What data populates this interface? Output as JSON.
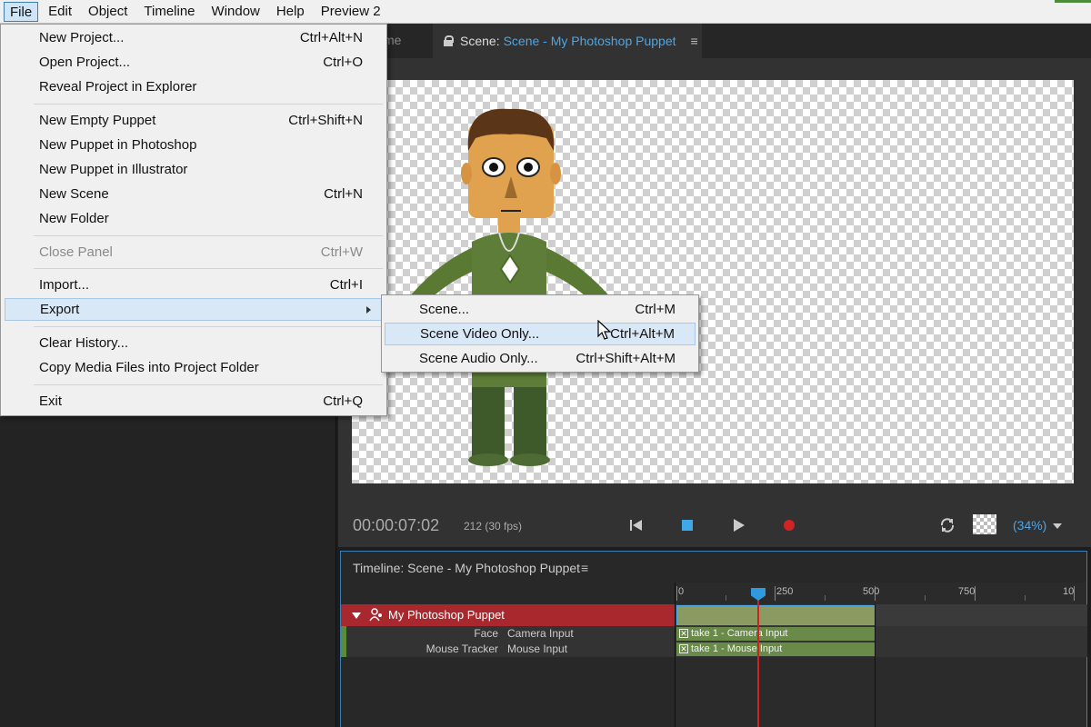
{
  "menubar": {
    "items": [
      "File",
      "Edit",
      "Object",
      "Timeline",
      "Window",
      "Help",
      "Preview 2"
    ]
  },
  "scene_tabs": {
    "partial_tab": "me",
    "active_label": "Scene:",
    "active_name": "Scene - My Photoshop Puppet",
    "menu_glyph": "≡"
  },
  "transport": {
    "timecode": "00:00:07:02",
    "fps": "212 (30 fps)",
    "zoom": "(34%)"
  },
  "timeline": {
    "title": "Timeline: Scene - My Photoshop Puppet",
    "menu_glyph": "≡",
    "ruler": [
      "0",
      "250",
      "500",
      "750",
      "10"
    ],
    "track_name": "My Photoshop Puppet",
    "rows": [
      {
        "behavior": "Face",
        "input": "Camera Input",
        "take": "take 1 - Camera Input"
      },
      {
        "behavior": "Mouse Tracker",
        "input": "Mouse Input",
        "take": "take 1 - Mouse Input"
      }
    ],
    "take_mark": "✕"
  },
  "file_menu": {
    "items": [
      {
        "label": "New Project...",
        "shortcut": "Ctrl+Alt+N"
      },
      {
        "label": "Open Project...",
        "shortcut": "Ctrl+O"
      },
      {
        "label": "Reveal Project in Explorer",
        "shortcut": ""
      },
      {
        "label": "New Empty Puppet",
        "shortcut": "Ctrl+Shift+N"
      },
      {
        "label": "New Puppet in Photoshop",
        "shortcut": ""
      },
      {
        "label": "New Puppet in Illustrator",
        "shortcut": ""
      },
      {
        "label": "New Scene",
        "shortcut": "Ctrl+N"
      },
      {
        "label": "New Folder",
        "shortcut": ""
      },
      {
        "label": "Close Panel",
        "shortcut": "Ctrl+W"
      },
      {
        "label": "Import...",
        "shortcut": "Ctrl+I"
      },
      {
        "label": "Export",
        "shortcut": ""
      },
      {
        "label": "Clear History...",
        "shortcut": ""
      },
      {
        "label": "Copy Media Files into Project Folder",
        "shortcut": ""
      },
      {
        "label": "Exit",
        "shortcut": "Ctrl+Q"
      }
    ]
  },
  "export_submenu": {
    "items": [
      {
        "label": "Scene...",
        "shortcut": "Ctrl+M"
      },
      {
        "label": "Scene Video Only...",
        "shortcut": "Ctrl+Alt+M"
      },
      {
        "label": "Scene Audio Only...",
        "shortcut": "Ctrl+Shift+Alt+M"
      }
    ]
  },
  "colors": {
    "accent_blue": "#4aa6e8",
    "track_red": "#a8282e",
    "record_red": "#d02424",
    "clip_green": "#6a8a4a"
  }
}
